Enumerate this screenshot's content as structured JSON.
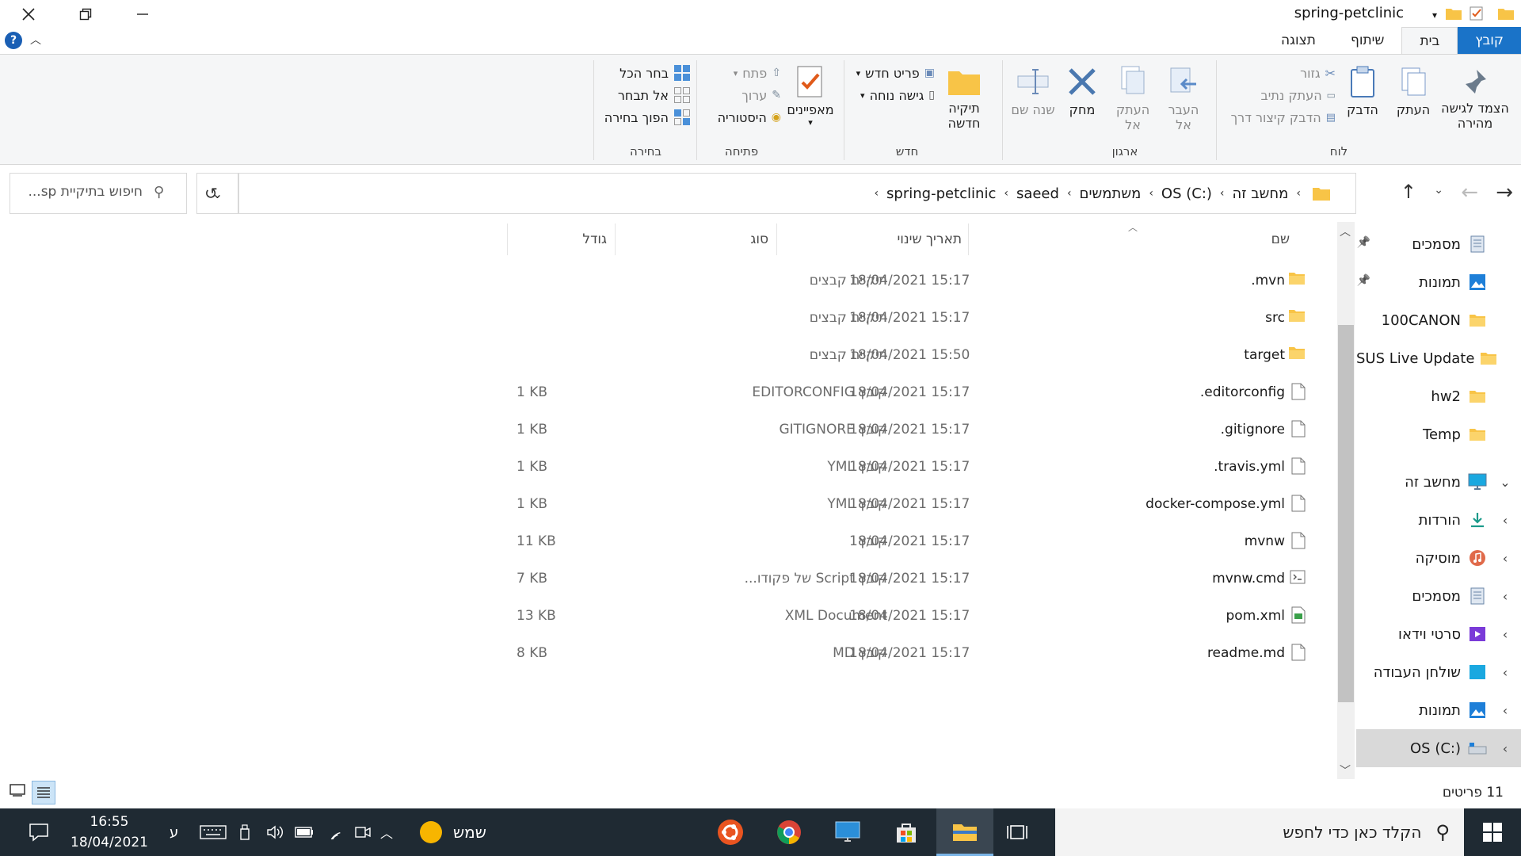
{
  "window": {
    "title": "spring-petclinic"
  },
  "tabs": [
    {
      "label": "קובץ",
      "active": true
    },
    {
      "label": "בית",
      "selected": true
    },
    {
      "label": "שיתוף"
    },
    {
      "label": "תצוגה"
    }
  ],
  "ribbon": {
    "clipboard": {
      "group": "לוח",
      "pin": "הצמד לגישה מהירה",
      "copy": "העתק",
      "paste": "הדבק",
      "cut": "גזור",
      "copy_path": "העתק נתיב",
      "paste_shortcut": "הדבק קיצור דרך"
    },
    "organize": {
      "group": "ארגון",
      "move_to": "העבר אל",
      "copy_to": "העתק אל",
      "delete": "מחק",
      "rename": "שנה שם"
    },
    "new": {
      "group": "חדש",
      "new_folder": "תיקיה חדשה",
      "new_item": "פריט חדש",
      "easy_access": "גישה נוחה"
    },
    "open": {
      "group": "פתיחה",
      "properties": "מאפיינים",
      "open": "פתח",
      "edit": "ערוך",
      "history": "היסטוריה"
    },
    "select": {
      "group": "בחירה",
      "select_all": "בחר הכל",
      "select_none": "אל תבחר",
      "invert": "הפוך בחירה"
    }
  },
  "address": {
    "crumbs": [
      "מחשב זה",
      "OS (C:)",
      "משתמשים",
      "saeed",
      "spring-petclinic"
    ],
    "search_placeholder": "חיפוש בתיקיית sp..."
  },
  "columns": {
    "name": "שם",
    "date": "תאריך שינוי",
    "type": "סוג",
    "size": "גודל"
  },
  "files": [
    {
      "name": ".mvn",
      "date": "18/04/2021 15:17",
      "type": "תיקיית קבצים",
      "size": "",
      "kind": "folder"
    },
    {
      "name": "src",
      "date": "18/04/2021 15:17",
      "type": "תיקיית קבצים",
      "size": "",
      "kind": "folder"
    },
    {
      "name": "target",
      "date": "18/04/2021 15:50",
      "type": "תיקיית קבצים",
      "size": "",
      "kind": "folder"
    },
    {
      "name": ".editorconfig",
      "date": "18/04/2021 15:17",
      "type": "קובץ EDITORCONFIG",
      "size": "1 KB",
      "kind": "file"
    },
    {
      "name": ".gitignore",
      "date": "18/04/2021 15:17",
      "type": "קובץ GITIGNORE",
      "size": "1 KB",
      "kind": "file"
    },
    {
      "name": ".travis.yml",
      "date": "18/04/2021 15:17",
      "type": "קובץ YML",
      "size": "1 KB",
      "kind": "file"
    },
    {
      "name": "docker-compose.yml",
      "date": "18/04/2021 15:17",
      "type": "קובץ YML",
      "size": "1 KB",
      "kind": "file"
    },
    {
      "name": "mvnw",
      "date": "18/04/2021 15:17",
      "type": "קובץ",
      "size": "11 KB",
      "kind": "file"
    },
    {
      "name": "mvnw.cmd",
      "date": "18/04/2021 15:17",
      "type": "קובץ Script של פקודו...",
      "size": "7 KB",
      "kind": "cmd"
    },
    {
      "name": "pom.xml",
      "date": "18/04/2021 15:17",
      "type": "XML Document",
      "size": "13 KB",
      "kind": "xml"
    },
    {
      "name": "readme.md",
      "date": "18/04/2021 15:17",
      "type": "קובץ MD",
      "size": "8 KB",
      "kind": "file"
    }
  ],
  "nav": {
    "quick": [
      {
        "label": "מסמכים",
        "icon": "documents-icon",
        "pinned": true
      },
      {
        "label": "תמונות",
        "icon": "pictures-icon",
        "pinned": true
      },
      {
        "label": "100CANON",
        "icon": "folder-icon"
      },
      {
        "label": "SUS Live Update",
        "icon": "folder-icon"
      },
      {
        "label": "hw2",
        "icon": "folder-icon"
      },
      {
        "label": "Temp",
        "icon": "folder-icon"
      }
    ],
    "this_pc": "מחשב זה",
    "pc_items": [
      {
        "label": "הורדות",
        "icon": "downloads-icon"
      },
      {
        "label": "מוסיקה",
        "icon": "music-icon"
      },
      {
        "label": "מסמכים",
        "icon": "documents-icon"
      },
      {
        "label": "סרטי וידאו",
        "icon": "videos-icon"
      },
      {
        "label": "שולחן העבודה",
        "icon": "desktop-icon"
      },
      {
        "label": "תמונות",
        "icon": "pictures-icon"
      },
      {
        "label": "OS (C:)",
        "icon": "drive-icon",
        "selected": true
      }
    ]
  },
  "status": {
    "items": "11 פריטים"
  },
  "taskbar": {
    "search_placeholder": "הקלד כאן כדי לחפש",
    "weather": "שמש",
    "lang": "ע",
    "time": "16:55",
    "date": "18/04/2021"
  },
  "colors": {
    "accent": "#1a73c8",
    "folder": "#f8c447",
    "taskbar": "#1f2a33"
  }
}
